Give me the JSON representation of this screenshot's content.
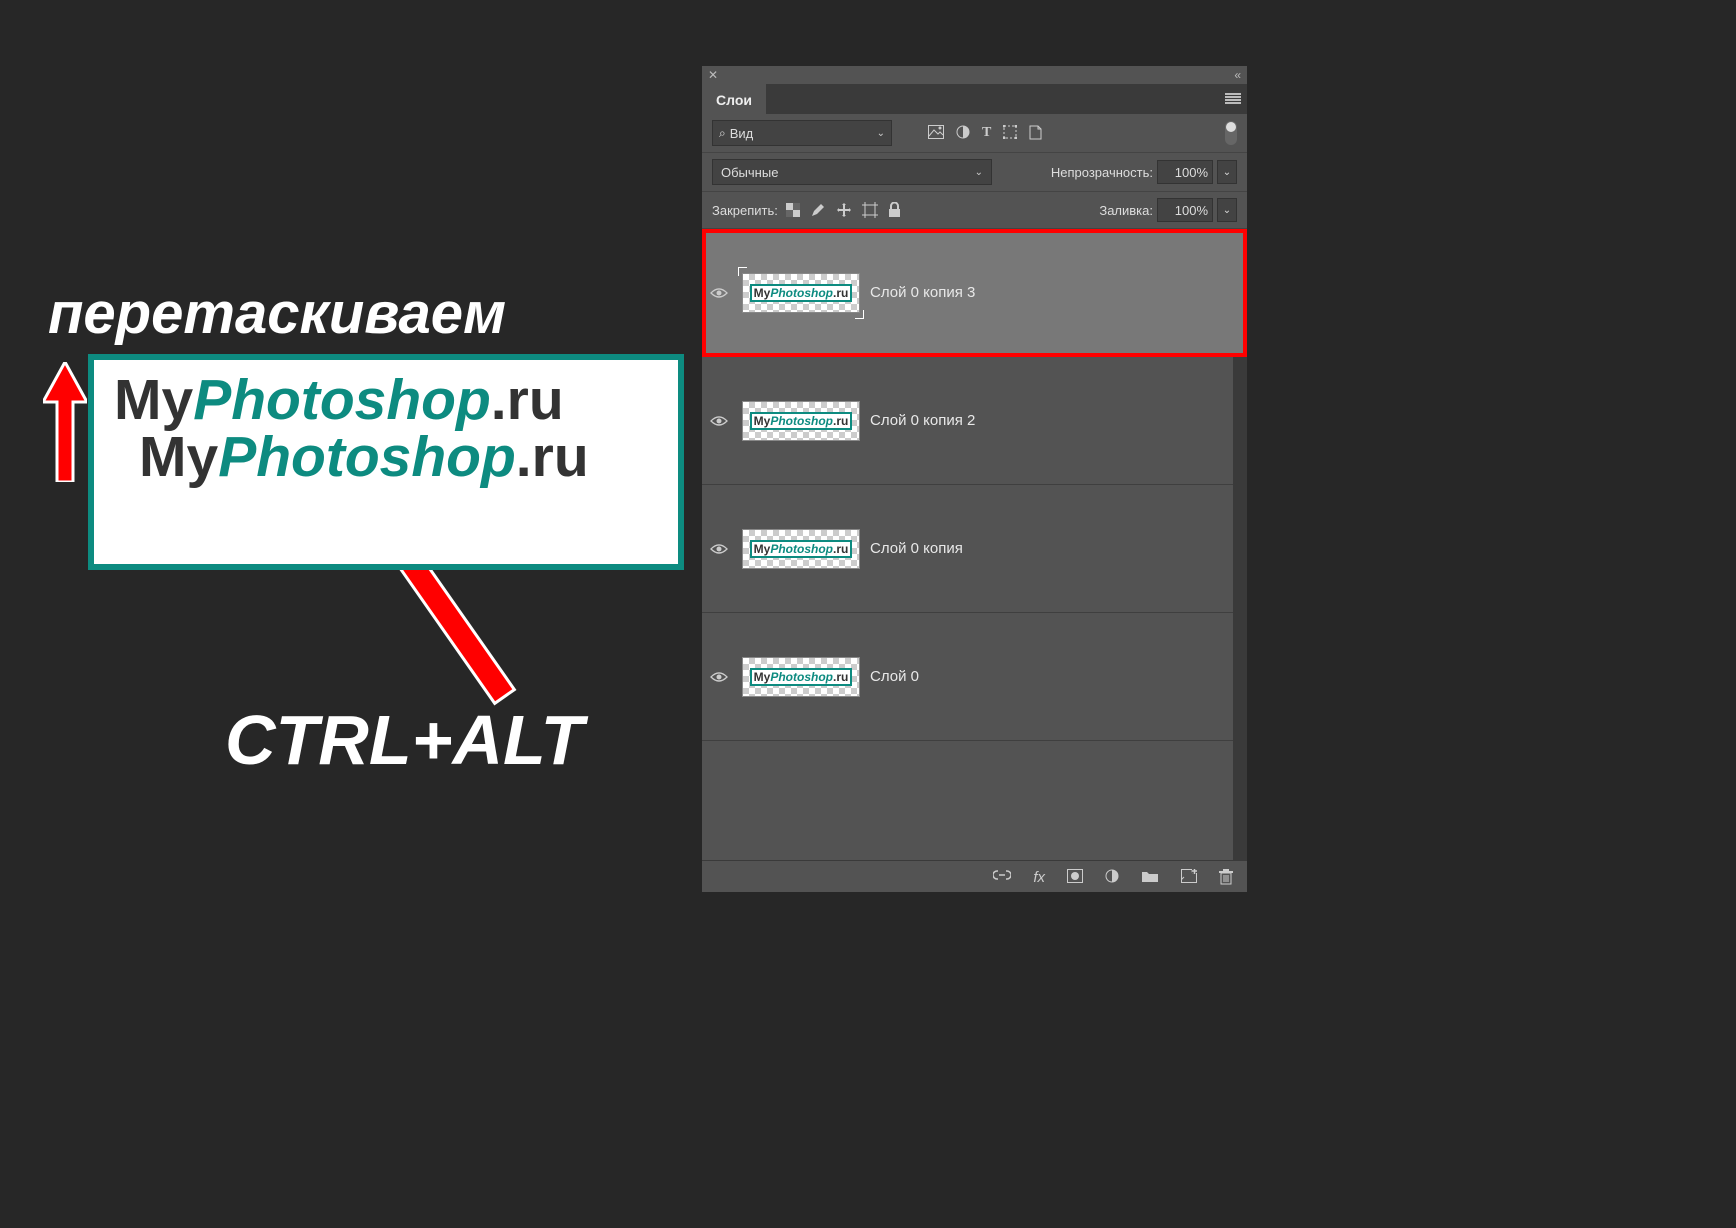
{
  "annotations": {
    "drag_label": "перетаскиваем",
    "hotkey_label": "CTRL+ALT"
  },
  "canvas": {
    "logo_my": "My",
    "logo_ps": "Photoshop",
    "logo_ru": ".ru"
  },
  "panel": {
    "tab_label": "Слои",
    "search": {
      "label": "Вид"
    },
    "blend": {
      "mode": "Обычные"
    },
    "opacity": {
      "label": "Непрозрачность:",
      "value": "100%"
    },
    "lock": {
      "label": "Закрепить:"
    },
    "fill": {
      "label": "Заливка:",
      "value": "100%"
    },
    "footer": {
      "fx_label": "fx"
    }
  },
  "layers": [
    {
      "name": "Слой 0 копия 3",
      "selected": true,
      "visible": true
    },
    {
      "name": "Слой 0 копия 2",
      "selected": false,
      "visible": true
    },
    {
      "name": "Слой 0 копия",
      "selected": false,
      "visible": true
    },
    {
      "name": "Слой 0",
      "selected": false,
      "visible": true
    }
  ],
  "thumb": {
    "my": "My",
    "ps": "Photoshop",
    "ru": ".ru"
  }
}
